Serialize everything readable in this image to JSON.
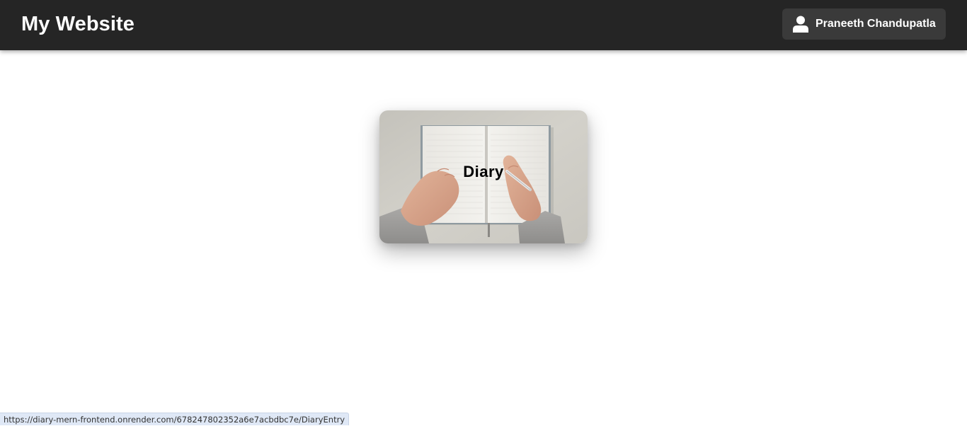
{
  "navbar": {
    "title": "My Website",
    "user": {
      "name": "Praneeth Chandupatla",
      "icon": "user-icon"
    },
    "colors": {
      "background": "#252525",
      "user_button": "#3a3a3a",
      "text": "#ffffff"
    }
  },
  "main": {
    "cards": [
      {
        "title": "Diary",
        "image": "open-notebook-with-hands-writing"
      }
    ]
  },
  "status_bar": {
    "url": "https://diary-mern-frontend.onrender.com/678247802352a6e7acbdbc7e/DiaryEntry"
  }
}
